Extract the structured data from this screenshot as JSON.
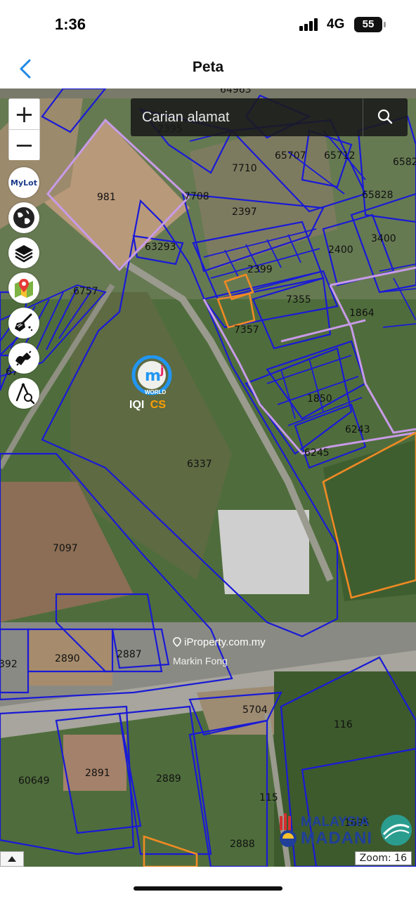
{
  "status_bar": {
    "time": "1:36",
    "network": "4G",
    "battery": "55"
  },
  "nav": {
    "title": "Peta"
  },
  "search": {
    "placeholder": "Carian alamat"
  },
  "map_tools": [
    "plus-icon",
    "minus-icon",
    "mylot-icon",
    "globe-icon",
    "layers-icon",
    "location-pin-icon",
    "broom-icon",
    "measure-icon",
    "compass-search-icon"
  ],
  "mylot_label": "MyLot",
  "lot_labels": [
    "64963",
    "2395",
    "65707",
    "65712",
    "6582",
    "7710",
    "7708",
    "981",
    "65828",
    "2397",
    "3400",
    "63293",
    "2400",
    "2399",
    "6757",
    "7355",
    "1864",
    "7357",
    "67",
    "1850",
    "6243",
    "6245",
    "6337",
    "7097",
    "2890",
    "2887",
    "392",
    "5704",
    "116",
    "60649",
    "2891",
    "2889",
    "115",
    "2888",
    "1695"
  ],
  "logos": {
    "iqi_world": "WORLD",
    "iqi_brand": "IQI",
    "iqi_cs": "CS",
    "madani_line1": "MALAYSIA",
    "madani_line2": "MADANI"
  },
  "watermark": {
    "site": "iProperty.com.my",
    "agent": "Markin Fong"
  },
  "zoom_level": "Zoom: 16",
  "colors": {
    "parcel_outline": "#1a1ad6",
    "highlight_purple": "#c89be8",
    "highlight_orange": "#f08a24",
    "accent_blue": "#1e88e5"
  }
}
